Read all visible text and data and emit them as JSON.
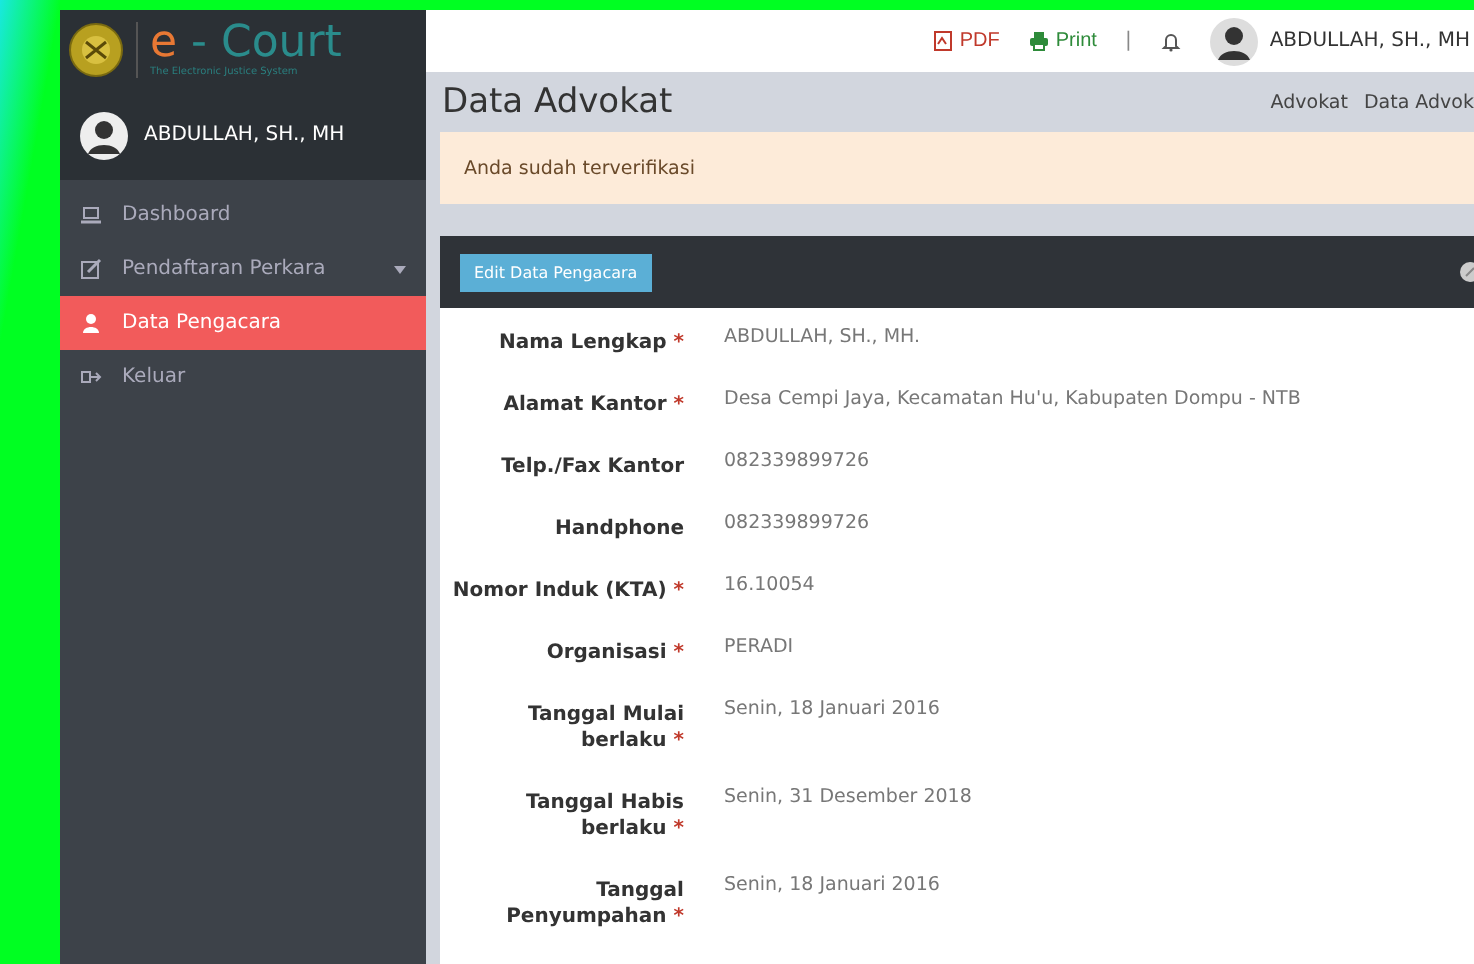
{
  "logo": {
    "title_prefix": "e",
    "title_rest": " - Court",
    "tagline": "The Electronic Justice System"
  },
  "sidebar": {
    "user": "ABDULLAH, SH., MH",
    "items": [
      {
        "label": "Dashboard",
        "selected": false,
        "has_submenu": false
      },
      {
        "label": "Pendaftaran Perkara",
        "selected": false,
        "has_submenu": true
      },
      {
        "label": "Data Pengacara",
        "selected": true,
        "has_submenu": false
      },
      {
        "label": "Keluar",
        "selected": false,
        "has_submenu": false
      }
    ]
  },
  "topbar": {
    "pdf": "PDF",
    "print": "Print",
    "separator": "|",
    "user": "ABDULLAH, SH., MH"
  },
  "page_title": "Data Advokat",
  "breadcrumb": [
    "Advokat",
    "Data Advok"
  ],
  "alert": "Anda sudah terverifikasi",
  "panel": {
    "edit_button": "Edit Data Pengacara",
    "fields": [
      {
        "label": "Nama Lengkap",
        "required_mark": "*",
        "value": "ABDULLAH, SH., MH."
      },
      {
        "label": "Alamat Kantor",
        "required_mark": "*",
        "value": "Desa Cempi Jaya, Kecamatan Hu'u, Kabupaten Dompu - NTB"
      },
      {
        "label": "Telp./Fax Kantor",
        "value": "082339899726"
      },
      {
        "label": "Handphone",
        "value": "082339899726"
      },
      {
        "label": "Nomor Induk (KTA)",
        "required_mark": "*",
        "value": "16.10054"
      },
      {
        "label": "Organisasi",
        "required_mark": "*",
        "value": "PERADI"
      },
      {
        "label": "Tanggal Mulai berlaku",
        "required_mark": "*",
        "value": "Senin, 18 Januari 2016"
      },
      {
        "label": "Tanggal Habis berlaku",
        "required_mark": "*",
        "value": "Senin, 31 Desember 2018"
      },
      {
        "label": "Tanggal Penyumpahan",
        "required_mark": "*",
        "value": "Senin, 18 Januari 2016"
      }
    ]
  }
}
